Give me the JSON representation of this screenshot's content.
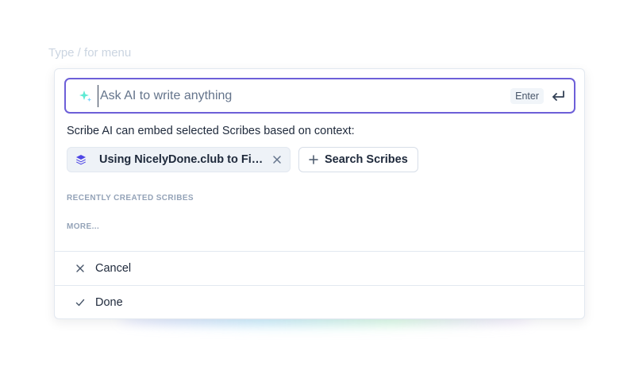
{
  "editor": {
    "hint": "Type / for menu"
  },
  "prompt": {
    "placeholder": "Ask AI to write anything",
    "value": "",
    "enter_label": "Enter",
    "icon": "sparkle-icon",
    "submit_icon": "enter-return-icon"
  },
  "context": {
    "description": "Scribe AI can embed selected Scribes based on context:",
    "selected_scribe": {
      "title": "Using NicelyDone.club to Find F...",
      "icon": "stack-icon"
    },
    "search_button_label": "Search Scribes"
  },
  "recent": {
    "heading": "RECENTLY CREATED SCRIBES",
    "more_label": "MORE..."
  },
  "actions": {
    "cancel_label": "Cancel",
    "done_label": "Done"
  },
  "colors": {
    "accent_border": "#6d5fd8",
    "sparkle": "#5eead4",
    "stack_icon": "#4f46e5",
    "muted_label": "#94a3b8"
  }
}
